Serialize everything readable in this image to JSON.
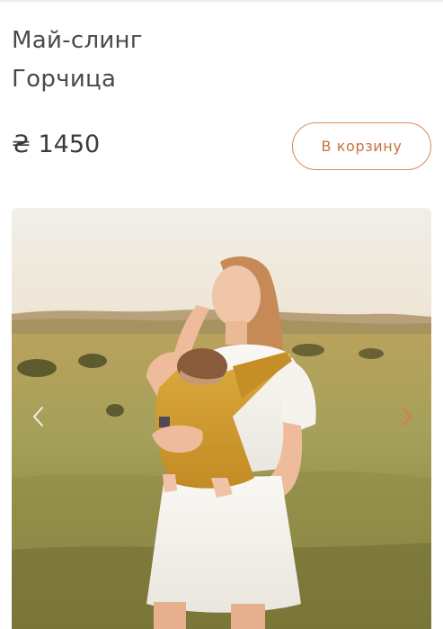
{
  "product": {
    "title_line1": "Май-слинг",
    "title_line2": "Горчица",
    "price": "₴ 1450"
  },
  "actions": {
    "add_to_cart_label": "В корзину"
  },
  "gallery": {
    "prev_icon": "chevron-left-icon",
    "next_icon": "chevron-right-icon"
  },
  "colors": {
    "accent": "#d98a5a",
    "accent_text": "#c9713c",
    "text": "#4a4a4a",
    "carrier_mustard": "#d6a032"
  }
}
